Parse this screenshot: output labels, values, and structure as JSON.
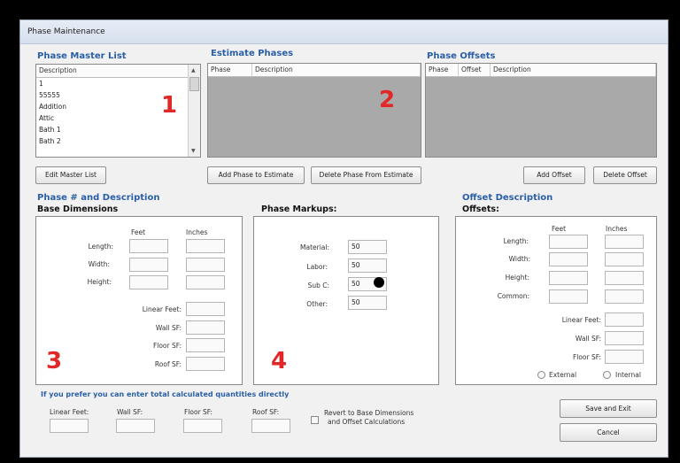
{
  "window": {
    "title": "Phase Maintenance"
  },
  "master": {
    "heading": "Phase Master List",
    "column": "Description",
    "items": [
      "1",
      "55555",
      "Addition",
      "Attic",
      "Bath 1",
      "Bath 2"
    ],
    "edit_button": "Edit Master List"
  },
  "estimate": {
    "heading": "Estimate Phases",
    "columns": [
      "Phase",
      "Description"
    ],
    "add_button": "Add Phase to Estimate",
    "delete_button": "Delete Phase From Estimate"
  },
  "offsets_list": {
    "heading": "Phase Offsets",
    "columns": [
      "Phase",
      "Offset",
      "Description"
    ],
    "add_button": "Add Offset",
    "delete_button": "Delete Offset"
  },
  "base": {
    "heading": "Phase # and Description",
    "subheading": "Base Dimensions",
    "col_feet": "Feet",
    "col_inches": "Inches",
    "rows": [
      "Length:",
      "Width:",
      "Height:"
    ],
    "linear_feet": "Linear Feet:",
    "wall_sf": "Wall SF:",
    "floor_sf": "Floor SF:",
    "roof_sf": "Roof SF:"
  },
  "markups": {
    "heading": "Phase Markups:",
    "items": [
      {
        "label": "Material:",
        "value": "50"
      },
      {
        "label": "Labor:",
        "value": "50"
      },
      {
        "label": "Sub C:",
        "value": "50"
      },
      {
        "label": "Other:",
        "value": "50"
      }
    ]
  },
  "offset_desc": {
    "heading": "Offset Description",
    "subheading": "Offsets:",
    "col_feet": "Feet",
    "col_inches": "Inches",
    "rows": [
      "Length:",
      "Width:",
      "Height:",
      "Common:"
    ],
    "linear_feet": "Linear Feet:",
    "wall_sf": "Wall SF:",
    "floor_sf": "Floor SF:",
    "external": "External",
    "internal": "Internal"
  },
  "direct": {
    "prompt": "If you prefer you can enter total calculated quantities directly",
    "linear_feet": "Linear Feet:",
    "wall_sf": "Wall SF:",
    "floor_sf": "Floor SF:",
    "roof_sf": "Roof SF:",
    "revert_label_1": "Revert to Base Dimensions",
    "revert_label_2": "and Offset Calculations"
  },
  "actions": {
    "save": "Save and Exit",
    "cancel": "Cancel"
  },
  "markers": [
    "1",
    "2",
    "3",
    "4"
  ]
}
